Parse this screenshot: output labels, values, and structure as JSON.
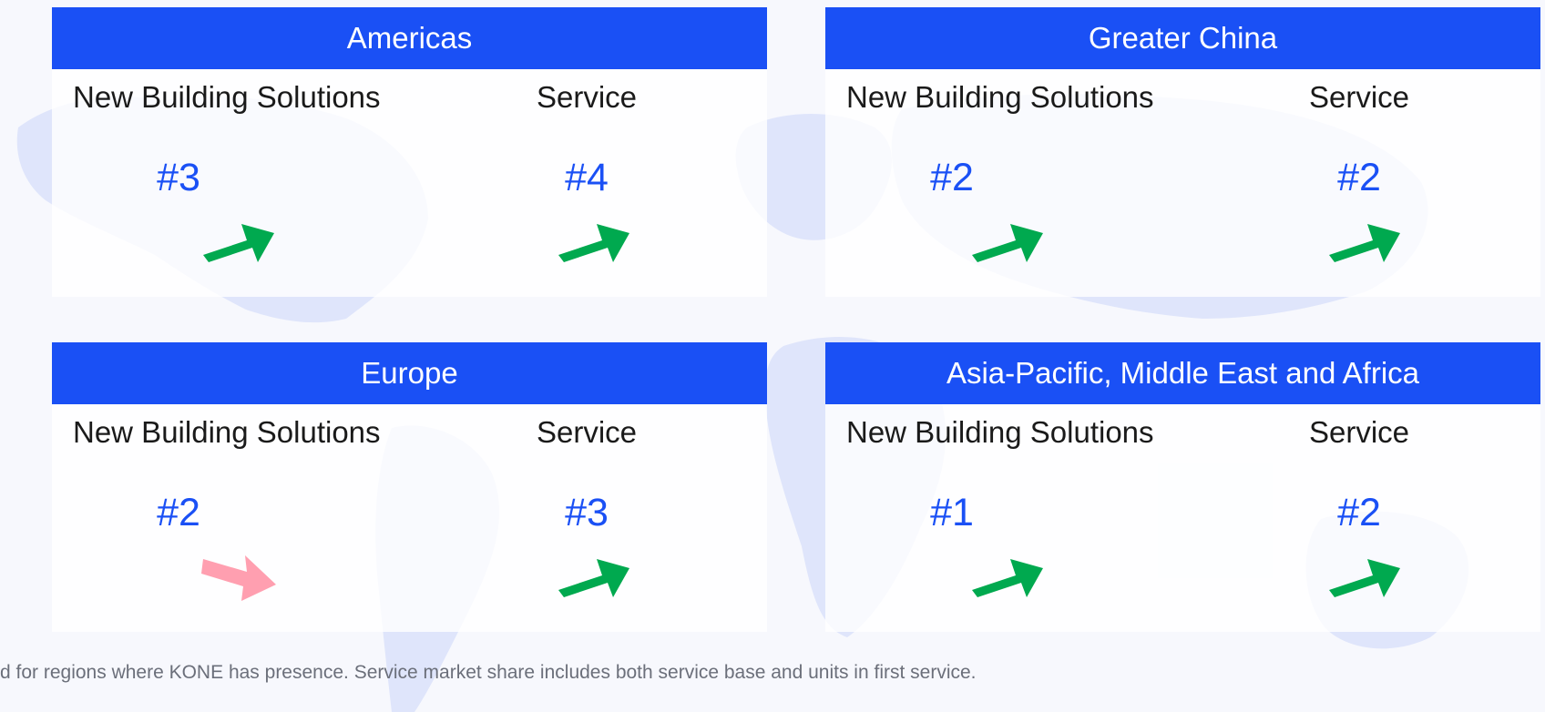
{
  "colors": {
    "header_bg": "#1a50f5",
    "rank_text": "#1a50f5",
    "trend_up": "#00a94f",
    "trend_down": "#ff9fb0"
  },
  "labels": {
    "nbs": "New Building Solutions",
    "service": "Service"
  },
  "regions": {
    "americas": {
      "title": "Americas",
      "nbs_rank": "#3",
      "nbs_trend": "up",
      "service_rank": "#4",
      "service_trend": "up"
    },
    "greater_china": {
      "title": "Greater China",
      "nbs_rank": "#2",
      "nbs_trend": "up",
      "service_rank": "#2",
      "service_trend": "up"
    },
    "europe": {
      "title": "Europe",
      "nbs_rank": "#2",
      "nbs_trend": "down",
      "service_rank": "#3",
      "service_trend": "up"
    },
    "apmea": {
      "title": "Asia-Pacific, Middle East and Africa",
      "nbs_rank": "#1",
      "nbs_trend": "up",
      "service_rank": "#2",
      "service_trend": "up"
    }
  },
  "footnote": "d for regions where KONE has presence. Service market share includes both service base and units in first service."
}
